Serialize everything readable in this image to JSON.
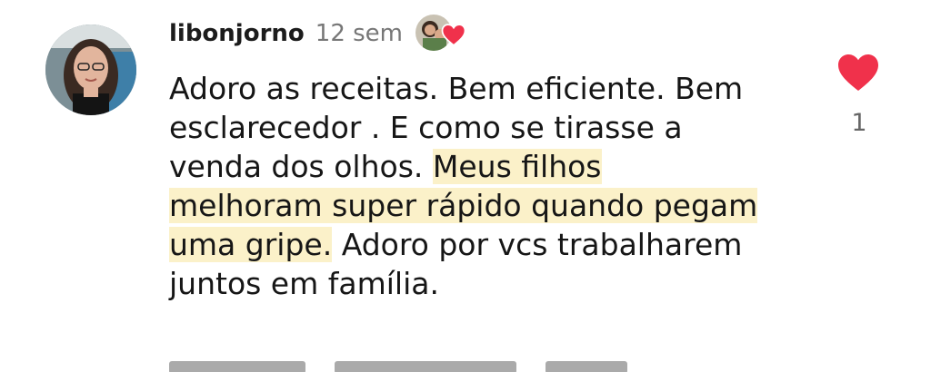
{
  "comment": {
    "username": "libonjorno",
    "time_ago": "12 sem",
    "text_before": "Adoro as receitas. Bem eficiente. Bem esclarecedor . E como se tirasse a venda dos olhos.  ",
    "text_highlight": "Meus filhos melhoram super rápido quando  pegam uma gripe.",
    "text_after": " Adoro por vcs trabalharem juntos  em família.",
    "like_count": "1",
    "like_icon": "heart-icon",
    "creator_like_icon": "creator-heart-icon",
    "colors": {
      "heart": "#f0314b",
      "highlight": "#fbf1c9",
      "username": "#1c1c1c",
      "meta": "#777777"
    }
  }
}
